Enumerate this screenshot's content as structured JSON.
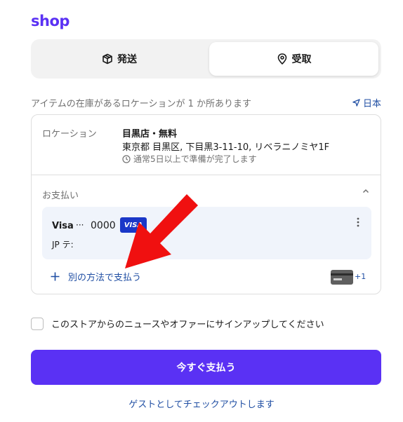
{
  "brand": {
    "logo_text": "shop",
    "accent_color": "#5a31f4",
    "link_color": "#1f4ea3"
  },
  "delivery_toggle": {
    "options": [
      {
        "label": "発送",
        "icon": "package-icon",
        "selected": false
      },
      {
        "label": "受取",
        "icon": "location-pin-icon",
        "selected": true
      }
    ]
  },
  "availability": {
    "text": "アイテムの在庫があるロケーションが 1 か所あります",
    "country": "日本",
    "country_icon": "navigation-arrow-icon"
  },
  "location": {
    "label": "ロケーション",
    "name": "目黒店・無料",
    "address": "東京都 目黒区, 下目黒3-11-10, リベラニノミヤ1F",
    "note": "通常5日以上で準備が完了します",
    "note_icon": "clock-icon"
  },
  "payment": {
    "title": "お支払い",
    "collapse_icon": "chevron-up-icon",
    "method": {
      "brand": "Visa",
      "dots": "···",
      "last4": "0000",
      "badge": "VISA",
      "name": "JP テ:",
      "badge_color": "#1a37c8"
    },
    "add_label": "別の方法で支払う",
    "add_icon": "plus-icon",
    "more_count": "+1"
  },
  "newsletter": {
    "label": "このストアからのニュースやオファーにサインアップしてください",
    "checked": false
  },
  "pay_button": {
    "label": "今すぐ支払う"
  },
  "guest_link": {
    "label": "ゲストとしてチェックアウトします"
  },
  "annotation": {
    "color": "#f01010"
  }
}
